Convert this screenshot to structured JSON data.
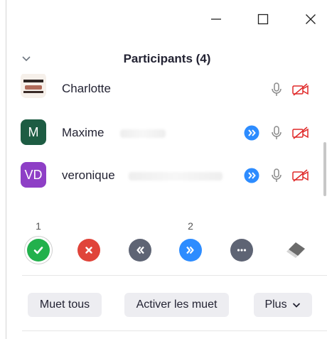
{
  "window_controls": {
    "minimize": "minimize",
    "maximize": "maximize",
    "close": "close"
  },
  "panel": {
    "title": "Participants (4)"
  },
  "participants": [
    {
      "name": "Charlotte",
      "initials": "",
      "avatar_color": "",
      "mic": "unmuted",
      "video": "off",
      "reaction": ""
    },
    {
      "name": "Maxime",
      "initials": "M",
      "avatar_color": "#1d5c43",
      "mic": "unmuted",
      "video": "off",
      "reaction": "go-faster"
    },
    {
      "name": "veronique",
      "initials": "VD",
      "avatar_color": "#8e3fc6",
      "mic": "unmuted",
      "video": "off",
      "reaction": "go-faster"
    }
  ],
  "nonverbal_feedback": [
    {
      "name": "yes",
      "count": "1",
      "color": "#22b14c",
      "icon": "check-icon"
    },
    {
      "name": "no",
      "count": "",
      "color": "#e0443a",
      "icon": "x-icon"
    },
    {
      "name": "go-slower",
      "count": "",
      "color": "#5e6474",
      "icon": "rewind-icon"
    },
    {
      "name": "go-faster",
      "count": "2",
      "color": "#2d8cff",
      "icon": "fast-forward-icon"
    },
    {
      "name": "more",
      "count": "",
      "color": "#5e6474",
      "icon": "more-icon"
    },
    {
      "name": "clear",
      "count": "",
      "color": "#6b6b6b",
      "icon": "eraser-icon"
    }
  ],
  "footer": {
    "mute_all_label": "Muet tous",
    "unmute_label": "Activer les muet",
    "more_label": "Plus"
  },
  "colors": {
    "muted_video": "#e02828",
    "reaction_blue": "#2d8cff",
    "mic_gray": "#8a8a8a"
  }
}
